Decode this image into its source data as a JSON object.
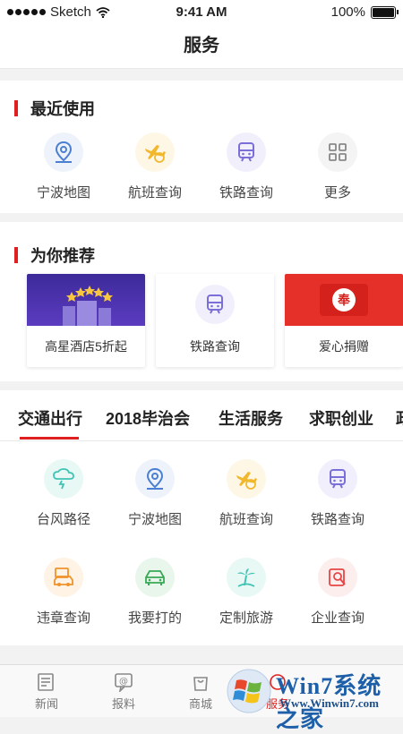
{
  "status": {
    "carrier": "Sketch",
    "time": "9:41 AM",
    "battery": "100%"
  },
  "nav": {
    "title": "服务"
  },
  "recent": {
    "title": "最近使用",
    "items": [
      {
        "label": "宁波地图",
        "icon": "map-pin-icon"
      },
      {
        "label": "航班查询",
        "icon": "airplane-icon"
      },
      {
        "label": "铁路查询",
        "icon": "train-icon"
      },
      {
        "label": "更多",
        "icon": "grid-icon"
      }
    ]
  },
  "recommend": {
    "title": "为你推荐",
    "cards": [
      {
        "label": "高星酒店5折起",
        "icon": "hotel-icon"
      },
      {
        "label": "铁路查询",
        "icon": "train-icon"
      },
      {
        "label": "爱心捐赠",
        "icon": "red-envelope-icon",
        "badge": "奉"
      }
    ]
  },
  "tabs": [
    "交通出行",
    "2018毕治会",
    "生活服务",
    "求职创业",
    "政"
  ],
  "services": {
    "row1": [
      {
        "label": "台风路径",
        "icon": "typhoon-icon"
      },
      {
        "label": "宁波地图",
        "icon": "map-pin-icon"
      },
      {
        "label": "航班查询",
        "icon": "airplane-icon"
      },
      {
        "label": "铁路查询",
        "icon": "train-icon"
      }
    ],
    "row2": [
      {
        "label": "违章查询",
        "icon": "car-violation-icon"
      },
      {
        "label": "我要打的",
        "icon": "taxi-icon"
      },
      {
        "label": "定制旅游",
        "icon": "palm-tree-icon"
      },
      {
        "label": "企业查询",
        "icon": "enterprise-search-icon"
      }
    ]
  },
  "bottom": {
    "items": [
      {
        "label": "新闻",
        "icon": "newspaper-icon"
      },
      {
        "label": "报料",
        "icon": "report-icon"
      },
      {
        "label": "商城",
        "icon": "shopping-bag-icon"
      },
      {
        "label": "服务",
        "icon": "service-icon"
      }
    ]
  },
  "watermark": {
    "brand": "Win7系统之家",
    "url": "Www.Winwin7.com"
  },
  "colors": {
    "accent": "#e02020",
    "blue": "#4a7fd1",
    "yellow": "#f2b82d",
    "purple": "#7a6fd8",
    "cyan": "#3fc3b5",
    "green": "#39a956",
    "orange": "#f0932b",
    "red": "#e84646"
  }
}
